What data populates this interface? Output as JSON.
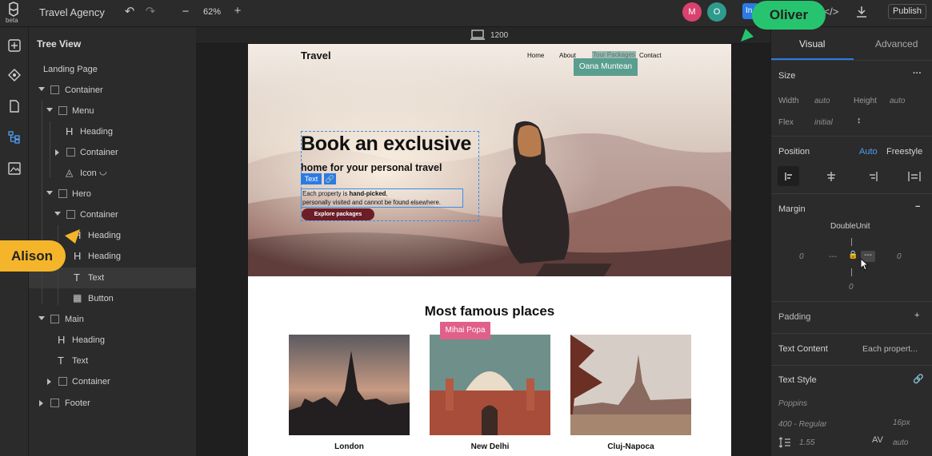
{
  "topbar": {
    "logo_text": "beta",
    "project_title": "Travel Agency",
    "zoom": "62%",
    "zoom_minus": "−",
    "zoom_plus": "+",
    "users": [
      {
        "initial": "M",
        "color": "#d9426e"
      },
      {
        "initial": "O",
        "color": "#2f9b8c"
      }
    ],
    "invite_label": "In",
    "publish_label": "Publish"
  },
  "tree": {
    "title": "Tree View",
    "root": "Landing Page",
    "items": [
      {
        "label": "Container",
        "type": "container"
      },
      {
        "label": "Menu",
        "type": "container"
      },
      {
        "label": "Heading",
        "type": "heading"
      },
      {
        "label": "Container",
        "type": "container"
      },
      {
        "label": "Icon",
        "type": "icon"
      },
      {
        "label": "Hero",
        "type": "container"
      },
      {
        "label": "Container",
        "type": "container"
      },
      {
        "label": "Heading",
        "type": "heading"
      },
      {
        "label": "Heading",
        "type": "heading"
      },
      {
        "label": "Text",
        "type": "text"
      },
      {
        "label": "Button",
        "type": "button"
      },
      {
        "label": "Main",
        "type": "container"
      },
      {
        "label": "Heading",
        "type": "heading"
      },
      {
        "label": "Text",
        "type": "text"
      },
      {
        "label": "Container",
        "type": "container"
      },
      {
        "label": "Footer",
        "type": "container"
      }
    ]
  },
  "canvas": {
    "viewport_width": "1200",
    "site": {
      "brand": "Travel",
      "nav": [
        "Home",
        "About",
        "Tour Packages",
        "Contact"
      ],
      "hero_title": "Book an exclusive",
      "hero_subtitle": "home for your personal travel",
      "hero_text_1": "Each property is ",
      "hero_text_bold": "hand-picked",
      "hero_text_2": ",",
      "hero_text_3": "personally visited and cannot be found elsewhere.",
      "cta": "Explore packages",
      "section_title": "Most famous places",
      "places": [
        "London",
        "New Delhi",
        "Cluj-Napoca"
      ]
    },
    "selection_badge": "Text"
  },
  "collaborators": {
    "oana": {
      "name": "Oana Muntean",
      "color": "#5a9e8f"
    },
    "mihai": {
      "name": "Mihai Popa",
      "color": "#e0608a"
    },
    "oliver": {
      "name": "Oliver",
      "color": "#27c46f"
    },
    "alison": {
      "name": "Alison",
      "color": "#f5b52a"
    }
  },
  "panel": {
    "tabs": [
      "Visual",
      "Advanced"
    ],
    "size": {
      "title": "Size",
      "width_label": "Width",
      "width_value": "auto",
      "height_label": "Height",
      "height_value": "auto",
      "flex_label": "Flex",
      "flex_value": "initial"
    },
    "position": {
      "title": "Position",
      "auto": "Auto",
      "freestyle": "Freestyle"
    },
    "margin": {
      "title": "Margin",
      "unit": "DoubleUnit",
      "left": "0",
      "left_dash": "---",
      "right": "0",
      "bottom": "0",
      "right_dash": "---"
    },
    "padding": {
      "title": "Padding"
    },
    "text_content": {
      "title": "Text Content",
      "value": "Each propert..."
    },
    "text_style": {
      "title": "Text Style",
      "font": "Poppins",
      "weight": "400 - Regular",
      "size": "16px",
      "line_height": "1.55",
      "letter_spacing": "auto"
    }
  }
}
